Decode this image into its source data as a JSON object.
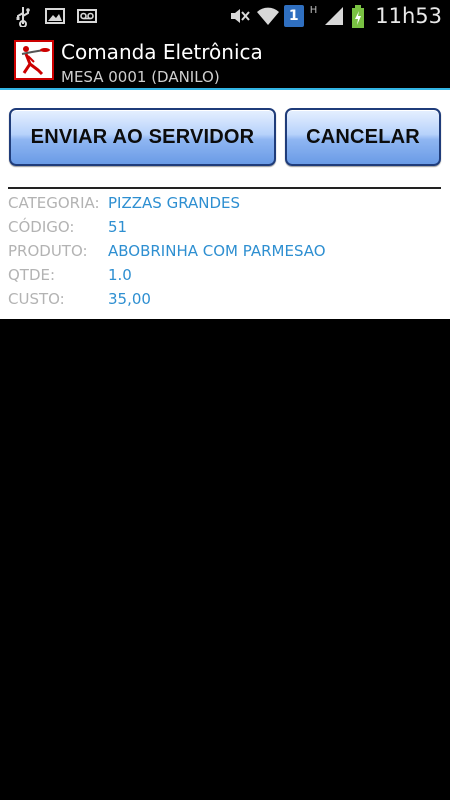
{
  "status_bar": {
    "left_icons": [
      "usb-icon",
      "image-icon",
      "voicemail-icon"
    ],
    "right_icons": [
      "mute-icon",
      "wifi-icon",
      "sim-badge-icon",
      "h-network-icon",
      "signal-icon",
      "battery-charging-icon"
    ],
    "sim_badge": "1",
    "network_type": "H",
    "time": "11h53"
  },
  "action_bar": {
    "title": "Comanda Eletrônica",
    "subtitle": "MESA 0001 (DANILO)"
  },
  "buttons": {
    "send_label": "ENVIAR AO SERVIDOR",
    "cancel_label": "CANCELAR"
  },
  "details": [
    {
      "label": "CATEGORIA:",
      "value": "PIZZAS GRANDES"
    },
    {
      "label": "CÓDIGO:",
      "value": "51"
    },
    {
      "label": "PRODUTO:",
      "value": "ABOBRINHA COM PARMESAO"
    },
    {
      "label": "QTDE:",
      "value": "1.0"
    },
    {
      "label": "CUSTO:",
      "value": "35,00"
    }
  ],
  "colors": {
    "accent": "#33b5e5",
    "value_text": "#2e8fd1",
    "label_text": "#b3b3b3",
    "button_border": "#1f3c7a"
  }
}
